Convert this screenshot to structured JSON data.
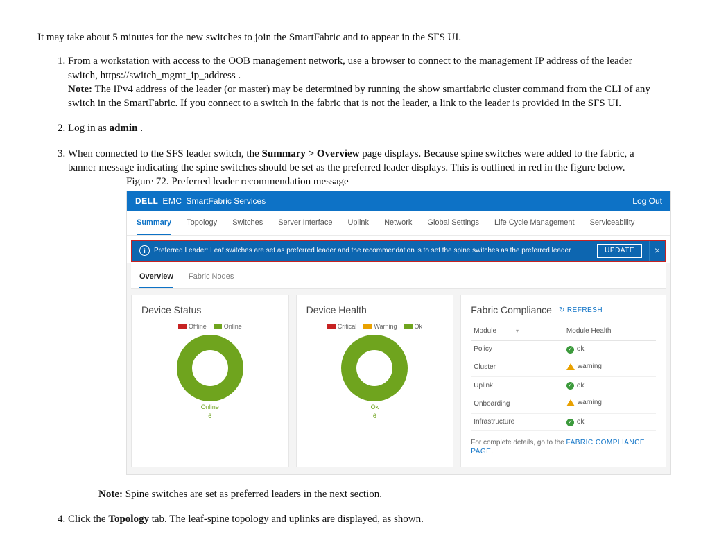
{
  "intro": "It may take about 5 minutes for the new switches to join the SmartFabric and to appear in the SFS UI.",
  "steps": {
    "s1_a": "From a workstation with access to the OOB management network, use a browser to connect to the management IP address of the leader switch, https://switch_mgmt_ip_address .",
    "note_label": "Note:",
    "s1_note": " The IPv4 address of the leader (or master) may be determined by running the show smartfabric cluster command from the CLI of any switch in the SmartFabric. If you connect to a switch in the fabric that is not the leader, a link to the leader is provided in the SFS UI.",
    "s2_a": "Log in as ",
    "s2_b": "admin",
    "s2_c": " .",
    "s3_a": "When connected to the SFS leader switch, the ",
    "s3_b": "Summary > Overview",
    "s3_c": " page displays. Because spine switches were added to the fabric, a banner message indicating the spine switches should be set as the preferred leader displays. This is outlined in red in the figure below.",
    "s4_a": "Click the ",
    "s4_b": "Topology",
    "s4_c": " tab. The leaf-spine topology and uplinks are displayed, as shown."
  },
  "figure_caption": "Figure 72. Preferred leader recommendation message",
  "after_note_label": "Note:",
  "after_note_text": " Spine switches are set as preferred leaders in the next section.",
  "sfs": {
    "brand_dell": "DELL",
    "brand_emc": "EMC",
    "brand_svc": "SmartFabric Services",
    "logout": "Log Out",
    "tabs": [
      "Summary",
      "Topology",
      "Switches",
      "Server Interface",
      "Uplink",
      "Network",
      "Global Settings",
      "Life Cycle Management",
      "Serviceability"
    ],
    "banner_text": "Preferred Leader: Leaf switches are set as preferred leader and the recommendation is to set the spine switches as the preferred leader",
    "banner_btn": "UPDATE",
    "subtabs": [
      "Overview",
      "Fabric Nodes"
    ],
    "card_status_title": "Device Status",
    "card_status_legend": [
      "Offline",
      "Online"
    ],
    "card_status_center": "Online",
    "card_status_center2": "6",
    "card_health_title": "Device Health",
    "card_health_legend": [
      "Critical",
      "Warning",
      "Ok"
    ],
    "card_health_center": "Ok",
    "card_health_center2": "6",
    "card_comp_title": "Fabric Compliance",
    "refresh": "REFRESH",
    "th_module": "Module",
    "th_health": "Module Health",
    "rows": [
      {
        "m": "Policy",
        "h": "ok",
        "s": "ok"
      },
      {
        "m": "Cluster",
        "h": "warning",
        "s": "warn"
      },
      {
        "m": "Uplink",
        "h": "ok",
        "s": "ok"
      },
      {
        "m": "Onboarding",
        "h": "warning",
        "s": "warn"
      },
      {
        "m": "Infrastructure",
        "h": "ok",
        "s": "ok"
      }
    ],
    "foot_a": "For complete details, go to the ",
    "foot_link": "FABRIC COMPLIANCE PAGE"
  }
}
